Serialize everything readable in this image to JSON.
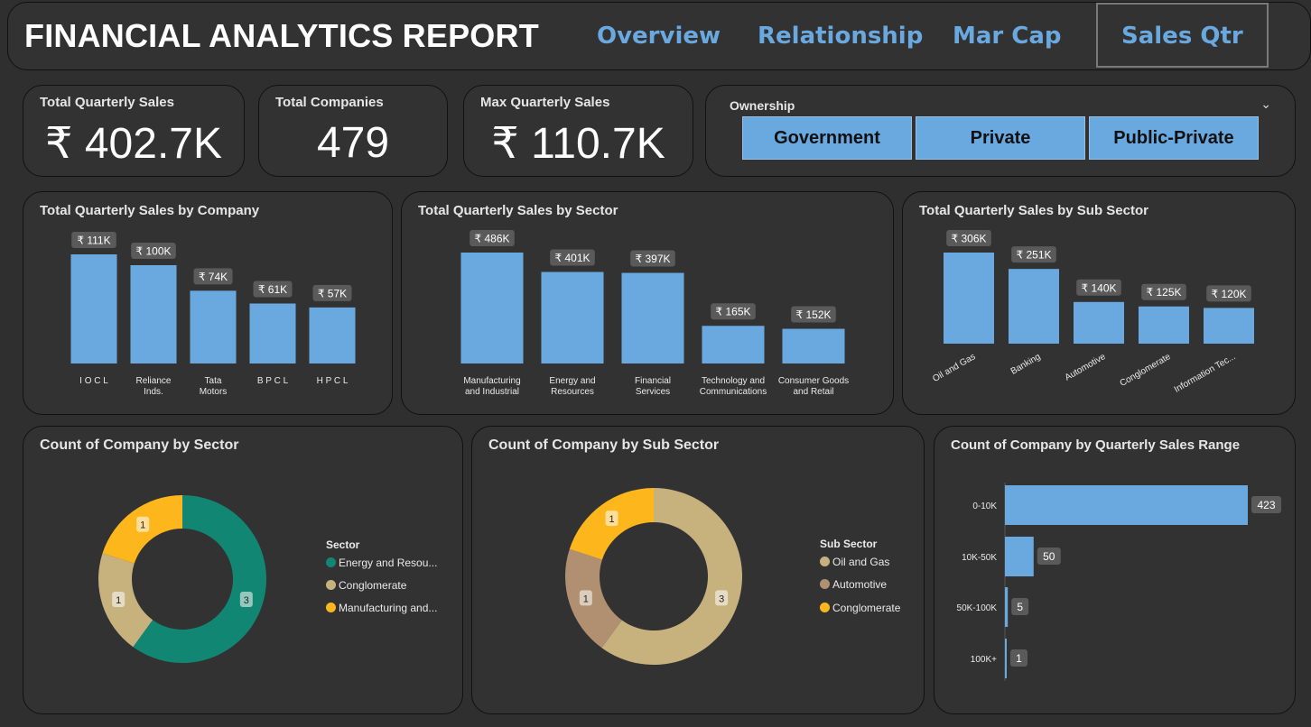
{
  "header": {
    "title": "FINANCIAL ANALYTICS REPORT",
    "tabs": [
      {
        "label": "Overview"
      },
      {
        "label": "Relationship"
      },
      {
        "label": "Mar Cap"
      },
      {
        "label": "Sales Qtr"
      }
    ],
    "active_tab": "Sales Qtr"
  },
  "kpis": {
    "total_sales": {
      "label": "Total Quarterly Sales",
      "value": "₹ 402.7K"
    },
    "total_companies": {
      "label": "Total Companies",
      "value": "479"
    },
    "max_sales": {
      "label": "Max Quarterly Sales",
      "value": "₹ 110.7K"
    }
  },
  "ownership": {
    "label": "Ownership",
    "options": [
      "Government",
      "Private",
      "Public-Private"
    ],
    "expand_icon": "chevron-down-icon"
  },
  "colors": {
    "bar": "#6aa9e0",
    "teal": "#118672",
    "tan": "#c7b27e",
    "yellow": "#fdb71c",
    "brown": "#b09070",
    "label_bg": "#5a5a5a"
  },
  "chart_data": [
    {
      "type": "bar",
      "title": "Total Quarterly Sales by Company",
      "categories": [
        "I O C L",
        "Reliance Inds.",
        "Tata Motors",
        "B P C L",
        "H P C L"
      ],
      "values": [
        111,
        100,
        74,
        61,
        57
      ],
      "data_labels": [
        "₹ 111K",
        "₹ 100K",
        "₹ 74K",
        "₹ 61K",
        "₹ 57K"
      ],
      "ylim": [
        0,
        111
      ]
    },
    {
      "type": "bar",
      "title": "Total Quarterly Sales by Sector",
      "categories": [
        "Manufacturing and Industrial",
        "Energy and Resources",
        "Financial Services",
        "Technology and Communications",
        "Consumer Goods and Retail"
      ],
      "values": [
        486,
        401,
        397,
        165,
        152
      ],
      "data_labels": [
        "₹ 486K",
        "₹ 401K",
        "₹ 397K",
        "₹ 165K",
        "₹ 152K"
      ],
      "ylim": [
        0,
        486
      ]
    },
    {
      "type": "bar",
      "title": "Total Quarterly Sales by Sub Sector",
      "categories": [
        "Oil and Gas",
        "Banking",
        "Automotive",
        "Conglomerate",
        "Information Tec..."
      ],
      "values": [
        306,
        251,
        140,
        125,
        120
      ],
      "data_labels": [
        "₹ 306K",
        "₹ 251K",
        "₹ 140K",
        "₹ 125K",
        "₹ 120K"
      ],
      "ylim": [
        0,
        306
      ]
    },
    {
      "type": "pie",
      "title": "Count of Company by Sector",
      "legend_title": "Sector",
      "categories": [
        "Energy and Resou...",
        "Conglomerate",
        "Manufacturing and..."
      ],
      "values": [
        3,
        1,
        1
      ],
      "colors": [
        "#118672",
        "#c7b27e",
        "#fdb71c"
      ]
    },
    {
      "type": "pie",
      "title": "Count of Company by Sub Sector",
      "legend_title": "Sub Sector",
      "categories": [
        "Oil and Gas",
        "Automotive",
        "Conglomerate"
      ],
      "values": [
        3,
        1,
        1
      ],
      "colors": [
        "#c7b27e",
        "#b09070",
        "#fdb71c"
      ]
    },
    {
      "type": "bar",
      "orientation": "horizontal",
      "title": "Count of Company by Quarterly Sales Range",
      "categories": [
        "0-10K",
        "10K-50K",
        "50K-100K",
        "100K+"
      ],
      "values": [
        423,
        50,
        5,
        1
      ],
      "xlim": [
        0,
        423
      ]
    }
  ]
}
